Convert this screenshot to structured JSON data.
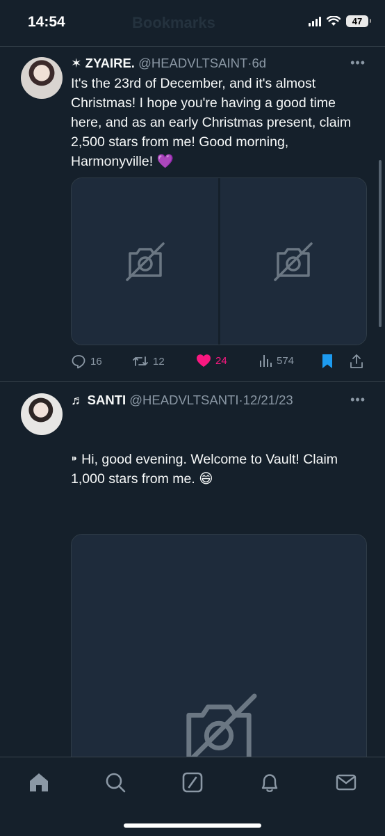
{
  "status_bar": {
    "time": "14:54",
    "battery": "47",
    "faded_title": "Bookmarks"
  },
  "tweets": [
    {
      "name": "✶ ZYAIRE.",
      "handle": "@HEADVLTSAINT",
      "separator": "·",
      "timestamp": "6d",
      "text": "It's the 23rd of December, and it's almost Christmas! I hope you're having a good time here, and as an early Christmas present, claim 2,500 stars from me! Good morning, Harmonyville! 💜",
      "media_count": 2,
      "stats": {
        "replies": "16",
        "retweets": "12",
        "likes": "24",
        "views": "574"
      },
      "liked": true,
      "bookmarked": true
    },
    {
      "name": "♬ SANTI",
      "handle": "@HEADVLTSANTI",
      "separator": "·",
      "timestamp": "12/21/23",
      "text": "⁍ Hi, good evening. Welcome to Vault! Claim 1,000 stars from me. 😄",
      "media_count": 1
    }
  ],
  "tabs": [
    {
      "icon": "home-icon"
    },
    {
      "icon": "search-icon"
    },
    {
      "icon": "grok-icon"
    },
    {
      "icon": "notifications-icon"
    },
    {
      "icon": "messages-icon"
    }
  ],
  "colors": {
    "background": "#15202b",
    "text": "#f7f9f9",
    "muted": "#8b98a5",
    "like": "#f91880",
    "bookmark": "#1d9bf0",
    "media_placeholder": "#1e2b3b"
  }
}
